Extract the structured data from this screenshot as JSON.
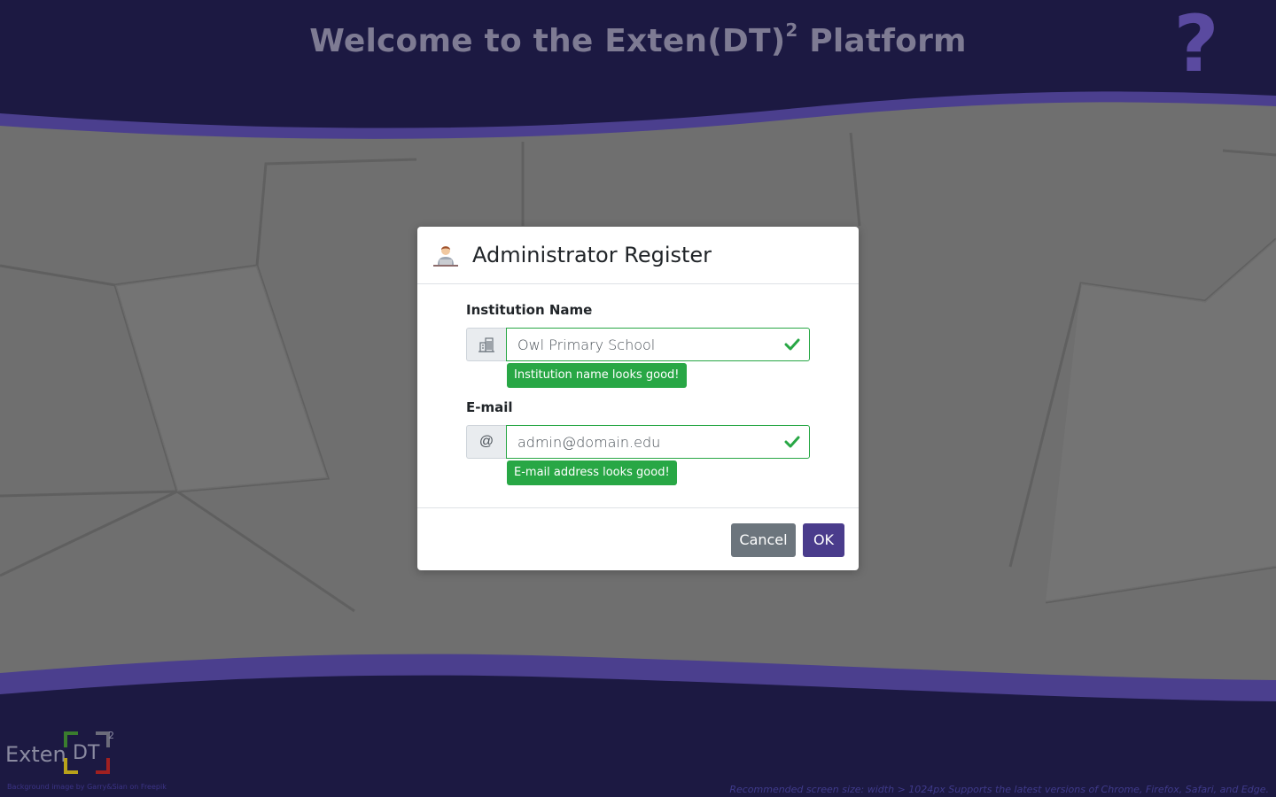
{
  "header": {
    "title": "Welcome to the Exten(DT)",
    "title_sup": "2",
    "title_suffix": " Platform",
    "help_symbol": "?"
  },
  "modal": {
    "title": "Administrator Register",
    "fields": [
      {
        "label": "Institution Name",
        "icon": "building-icon",
        "value": "Owl Primary School",
        "feedback": "Institution name looks good!"
      },
      {
        "label": "E-mail",
        "icon": "at-symbol",
        "addon_text": "@",
        "value": "admin@domain.edu",
        "feedback": "E-mail address looks good!"
      }
    ],
    "cancel_label": "Cancel",
    "ok_label": "OK"
  },
  "footer": {
    "logo_text": "Exten",
    "logo_dt": "DT",
    "logo_sup": "2",
    "credit": "Background image by Garry&Sian on Freepik",
    "note": "Recommended screen size: width > 1024px Supports the latest versions of Chrome, Firefox, Safari, and Edge."
  },
  "colors": {
    "band": "#1c1942",
    "accent": "#4a3c8c",
    "success": "#28a745",
    "secondary": "#6c757d"
  }
}
